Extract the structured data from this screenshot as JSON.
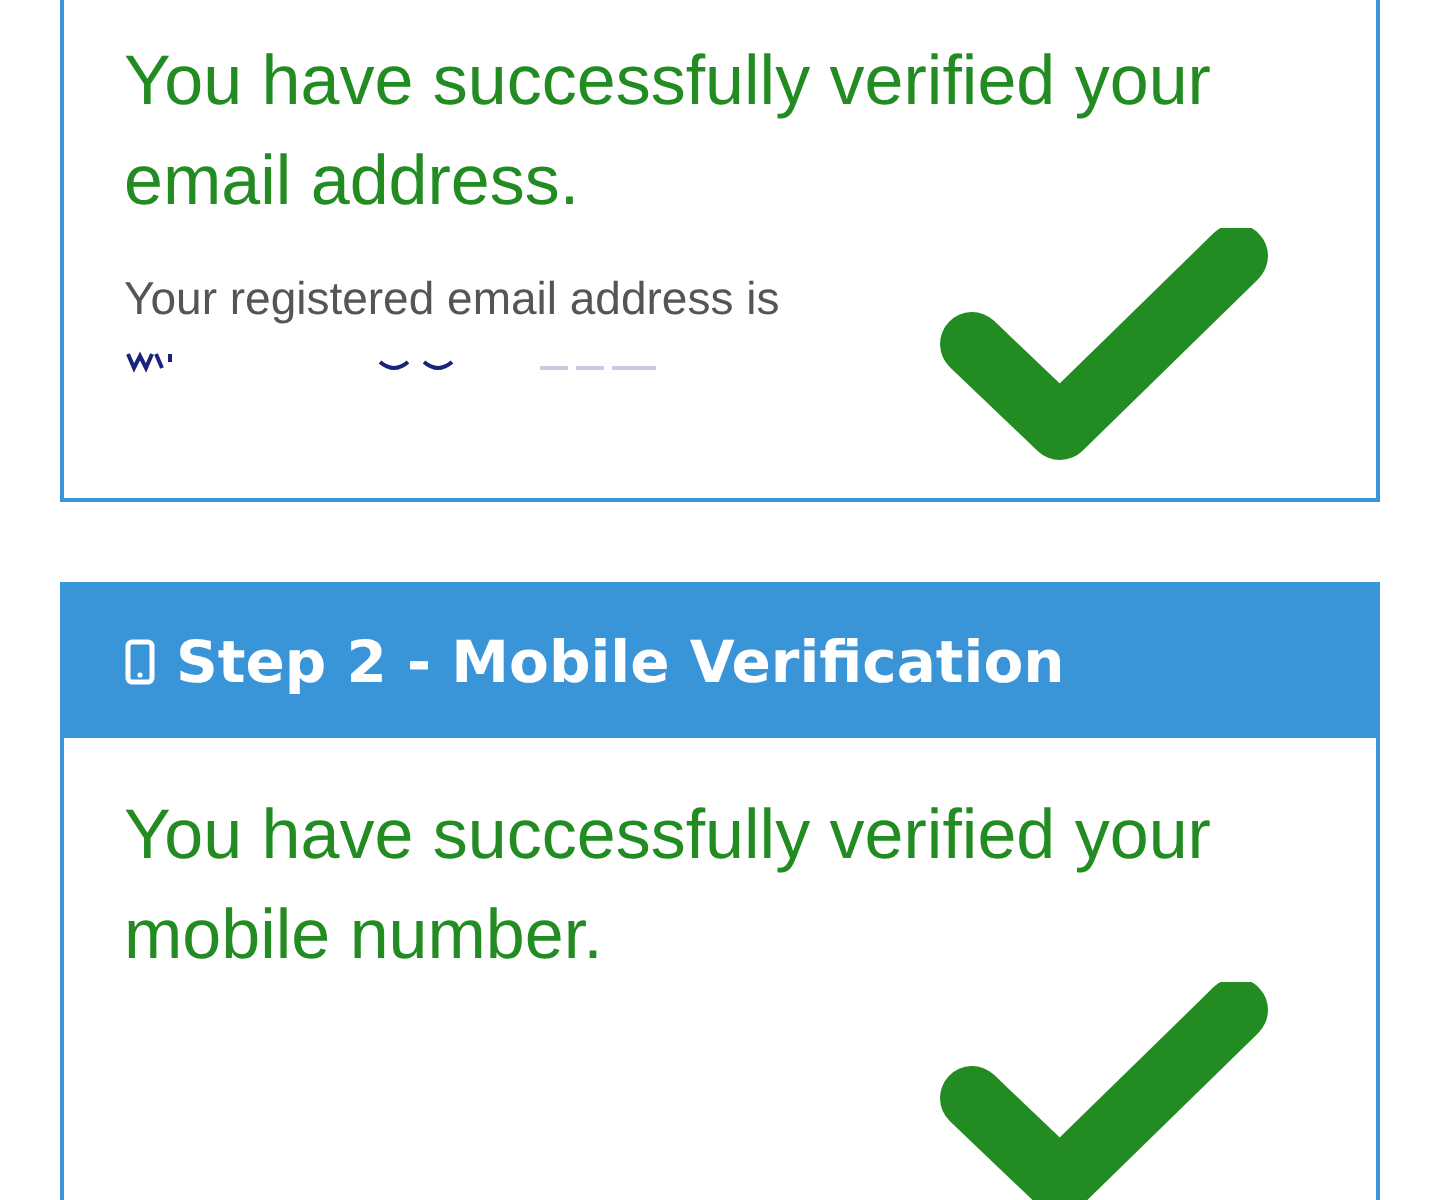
{
  "cards": [
    {
      "message": "You have successfully verified your email address.",
      "detail": "Your registered email address is"
    },
    {
      "header": {
        "title": "Step 2 - Mobile Verification"
      },
      "message": "You have successfully verified your mobile number."
    }
  ]
}
